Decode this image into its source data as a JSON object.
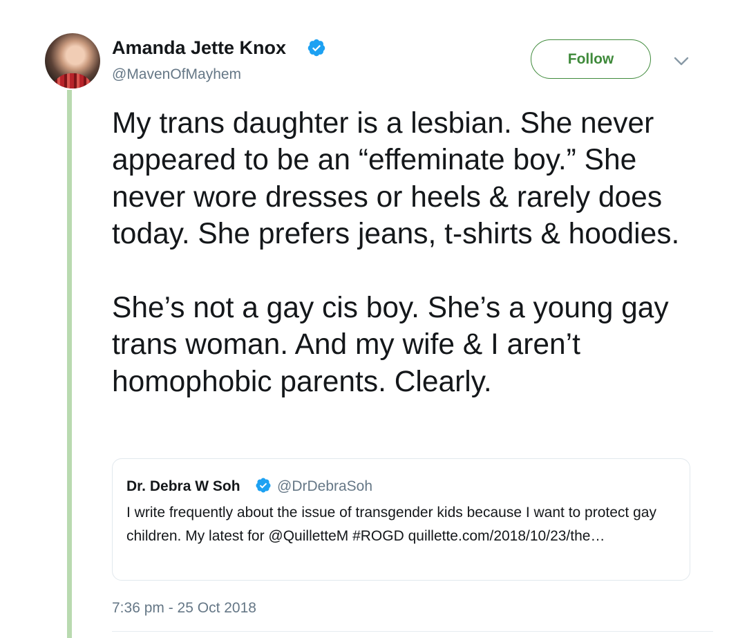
{
  "tweet": {
    "author": {
      "display_name": "Amanda Jette Knox",
      "handle": "@MavenOfMayhem",
      "verified_icon": "verified-badge-icon",
      "avatar_icon": "profile-photo"
    },
    "follow_label": "Follow",
    "menu_icon": "chevron-down-icon",
    "text_paragraphs": [
      "My trans daughter is a lesbian. She never appeared to be an “effeminate boy.” She never wore dresses or heels & rarely does today. She prefers jeans, t-shirts & hoodies.",
      "She’s not a gay cis boy. She’s a young gay trans woman. And my wife & I aren’t homophobic parents. Clearly."
    ],
    "quoted": {
      "display_name": "Dr. Debra W Soh",
      "handle": "@DrDebraSoh",
      "text": "I write frequently about the issue of transgender kids because I want to protect gay children. My latest for @QuilletteM  #ROGD quillette.com/2018/10/23/the…"
    },
    "timestamp": "7:36 pm - 25 Oct 2018"
  },
  "colors": {
    "accent_green": "#3f8a3b",
    "thread_line": "#b9dab0",
    "verified_blue": "#1da1f2",
    "secondary_text": "#657786"
  }
}
